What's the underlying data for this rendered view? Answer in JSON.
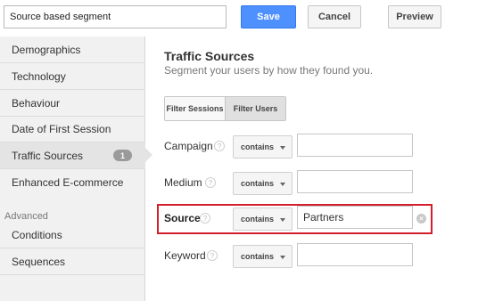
{
  "header": {
    "segment_name": "Source based segment",
    "save_label": "Save",
    "cancel_label": "Cancel",
    "preview_label": "Preview"
  },
  "sidebar": {
    "items": [
      {
        "label": "Demographics"
      },
      {
        "label": "Technology"
      },
      {
        "label": "Behaviour"
      },
      {
        "label": "Date of First Session"
      },
      {
        "label": "Traffic Sources",
        "badge": "1",
        "active": true
      },
      {
        "label": "Enhanced E-commerce"
      }
    ],
    "advanced_label": "Advanced",
    "advanced_items": [
      {
        "label": "Conditions"
      },
      {
        "label": "Sequences"
      }
    ]
  },
  "main": {
    "title": "Traffic Sources",
    "subtitle": "Segment your users by how they found you.",
    "filter_sessions_label": "Filter Sessions",
    "filter_users_label": "Filter Users",
    "selected_filter": "Filter Users",
    "rows": [
      {
        "label": "Campaign",
        "operator": "contains",
        "value": ""
      },
      {
        "label": "Medium",
        "operator": "contains",
        "value": ""
      },
      {
        "label": "Source",
        "operator": "contains",
        "value": "Partners",
        "highlighted": true
      },
      {
        "label": "Keyword",
        "operator": "contains",
        "value": ""
      }
    ],
    "help_glyph": "?",
    "clear_glyph": "×"
  },
  "colors": {
    "accent_blue": "#4d90fe",
    "highlight_red": "#d21f2a",
    "sidebar_bg": "#f1f1f1"
  }
}
